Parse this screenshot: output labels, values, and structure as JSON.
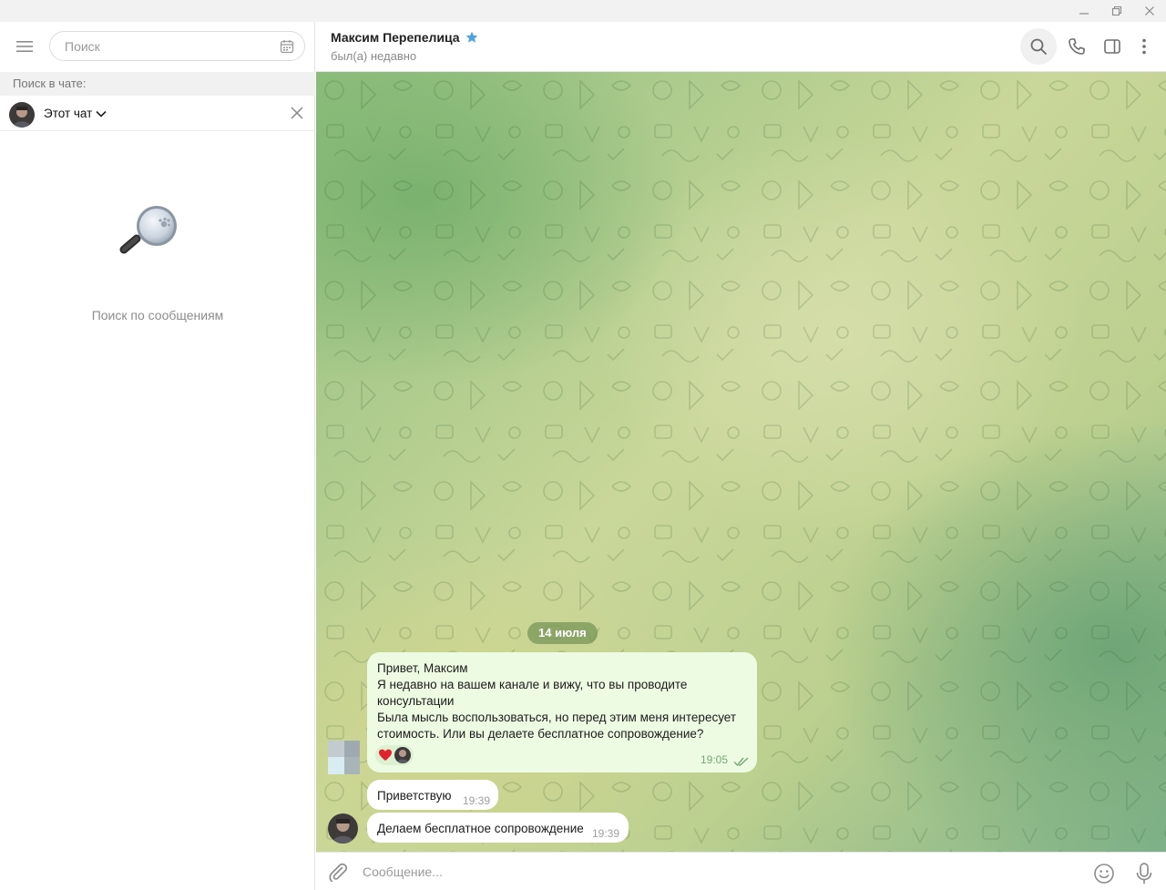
{
  "window": {
    "controls": [
      "minimize",
      "restore",
      "close"
    ]
  },
  "sidebar": {
    "search_placeholder": "Поиск",
    "search_in_chat_label": "Поиск в чате:",
    "chat_filter_label": "Этот чат",
    "empty_state_text": "Поиск по сообщениям"
  },
  "chat": {
    "name": "Максим Перепелица",
    "status": "был(а) недавно",
    "date_separator": "14 июля",
    "messages": [
      {
        "direction": "incoming",
        "lines": [
          "Привет, Максим",
          "Я недавно на вашем канале и вижу, что вы проводите",
          "консультации",
          "Была мысль воспользоваться, но перед этим меня интересует",
          "стоимость. Или вы делаете бесплатное сопровождение?"
        ],
        "time": "19:05",
        "reaction": "heart"
      },
      {
        "direction": "outgoing",
        "text": "Приветствую",
        "time": "19:39"
      },
      {
        "direction": "outgoing",
        "text": "Делаем бесплатное сопровождение",
        "time": "19:39"
      }
    ]
  },
  "composer": {
    "placeholder": "Сообщение..."
  },
  "colors": {
    "accent": "#4fa3e0",
    "incoming_bubble": "#eefbe3",
    "time_green": "#74a873",
    "reaction_heart": "#e0232e"
  },
  "icons": {
    "menu": "hamburger-icon",
    "calendar": "calendar-icon",
    "close": "close-icon",
    "search": "search-icon",
    "call": "phone-icon",
    "sidebar_toggle": "sidebar-toggle-icon",
    "more": "more-vertical-icon",
    "attach": "paperclip-icon",
    "emoji": "emoji-icon",
    "mic": "microphone-icon"
  }
}
